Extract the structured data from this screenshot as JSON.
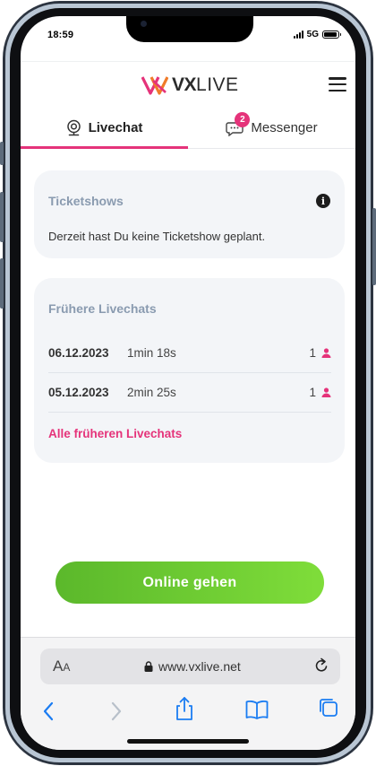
{
  "status": {
    "time": "18:59",
    "network": "5G"
  },
  "header": {
    "logo_vx": "VX",
    "logo_live": "LIVE"
  },
  "tabs": [
    {
      "label": "Livechat",
      "active": true
    },
    {
      "label": "Messenger",
      "active": false,
      "badge": "2"
    }
  ],
  "ticketshows": {
    "title": "Ticketshows",
    "text": "Derzeit hast Du keine Ticketshow geplant."
  },
  "history": {
    "title": "Frühere Livechats",
    "rows": [
      {
        "date": "06.12.2023",
        "duration": "1min 18s",
        "count": "1"
      },
      {
        "date": "05.12.2023",
        "duration": "2min 25s",
        "count": "1"
      }
    ],
    "all_link": "Alle früheren Livechats"
  },
  "online_button": "Online gehen",
  "browser": {
    "aa_large": "A",
    "aa_small": "A",
    "url": "www.vxlive.net"
  },
  "colors": {
    "accent": "#e5337a",
    "green_start": "#5bb82b",
    "green_end": "#7fdd3a",
    "card_bg": "#f3f5f8",
    "card_title": "#8a9bb0",
    "ios_blue": "#1a7cf2"
  }
}
